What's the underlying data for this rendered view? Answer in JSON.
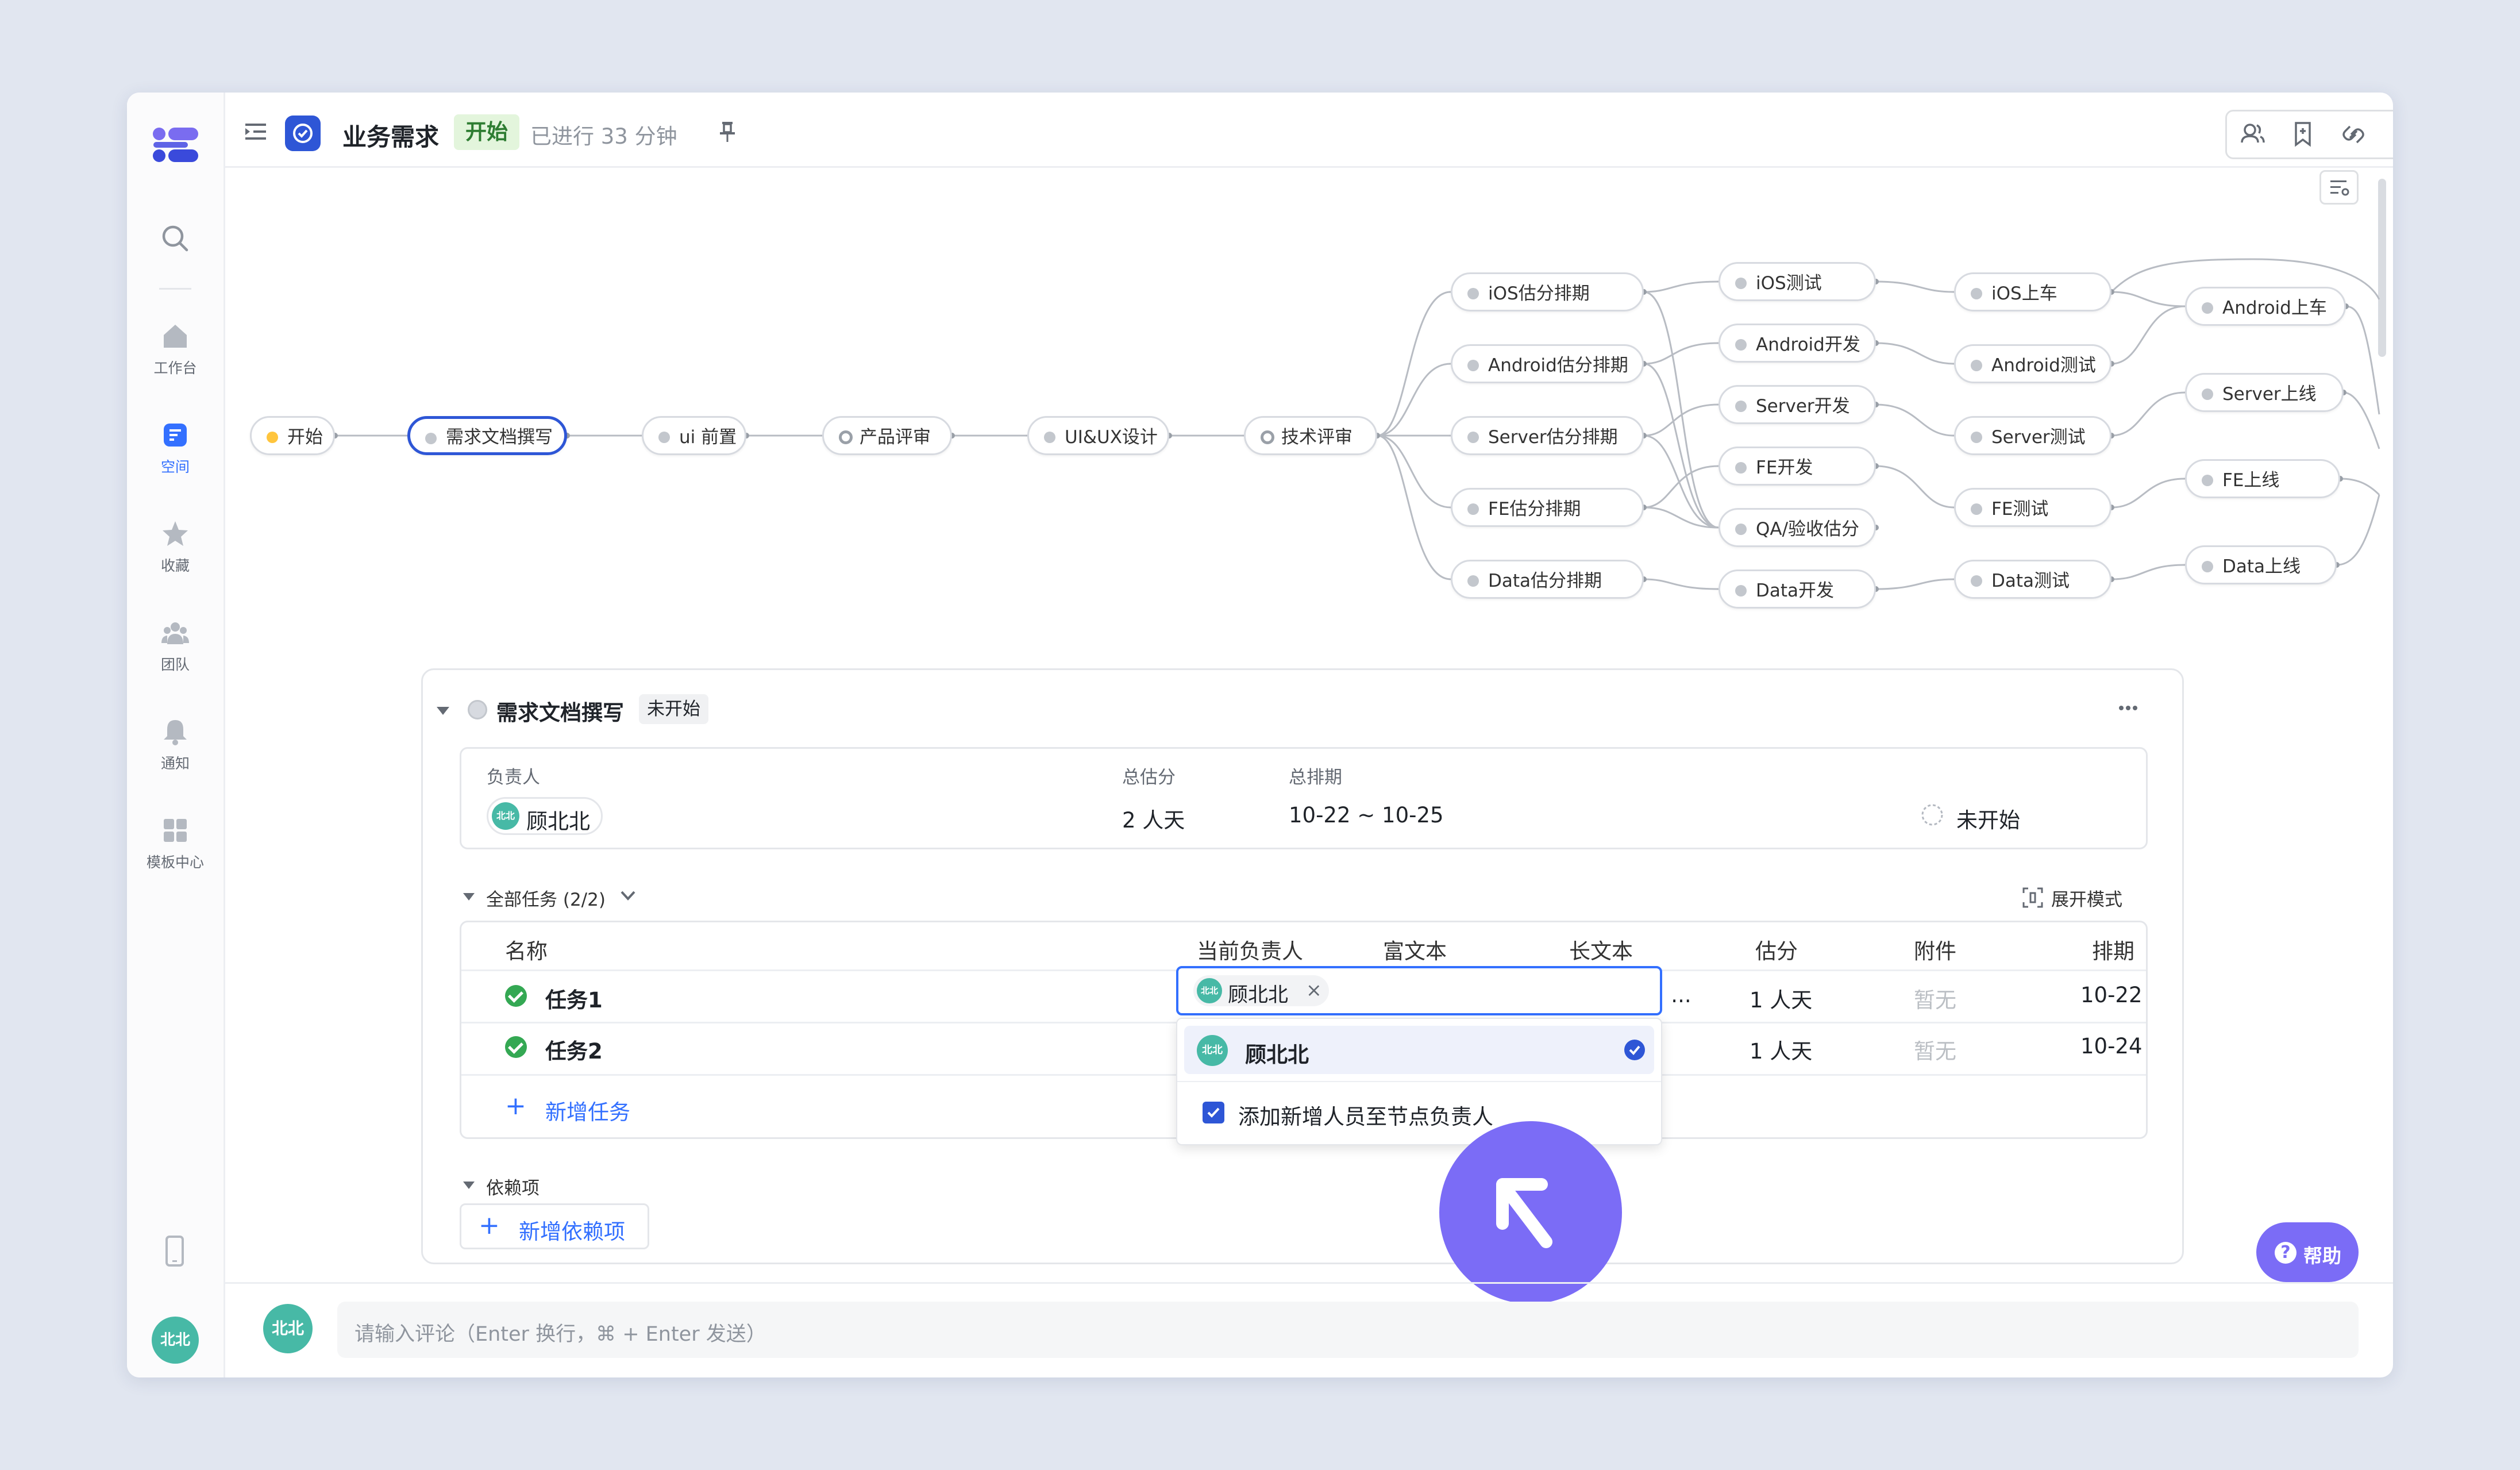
{
  "header": {
    "title": "业务需求",
    "status_badge": "开始",
    "elapsed": "已进行 33 分钟"
  },
  "sidebar": {
    "items": [
      {
        "label": "工作台",
        "icon": "home-icon"
      },
      {
        "label": "空间",
        "icon": "space-icon"
      },
      {
        "label": "收藏",
        "icon": "star-icon"
      },
      {
        "label": "团队",
        "icon": "team-icon"
      },
      {
        "label": "通知",
        "icon": "bell-icon"
      },
      {
        "label": "模板中心",
        "icon": "template-icon"
      }
    ],
    "user_avatar": "北北"
  },
  "flow": {
    "main": [
      "开始",
      "需求文档撰写",
      "ui 前置",
      "产品评审",
      "UI&UX设计",
      "技术评审"
    ],
    "estimate": [
      "iOS估分排期",
      "Android估分排期",
      "Server估分排期",
      "FE估分排期",
      "Data估分排期"
    ],
    "develop": [
      "iOS测试",
      "Android开发",
      "Server开发",
      "FE开发",
      "QA/验收估分",
      "Data开发"
    ],
    "test": [
      "iOS上车",
      "Android测试",
      "Server测试",
      "FE测试",
      "Data测试"
    ],
    "release": [
      "Android上车",
      "Server上线",
      "FE上线",
      "Data上线"
    ]
  },
  "panel": {
    "title": "需求文档撰写",
    "status": "未开始",
    "info": {
      "owner_label": "负责人",
      "owner": "顾北北",
      "owner_avatar": "北北",
      "estimate_label": "总估分",
      "estimate": "2 人天",
      "schedule_label": "总排期",
      "schedule": "10-22 ~ 10-25",
      "state": "未开始"
    },
    "tasks": {
      "section_label": "全部任务 (2/2)",
      "expand_mode": "展开模式",
      "columns": [
        "名称",
        "当前负责人",
        "富文本",
        "长文本",
        "估分",
        "附件",
        "排期"
      ],
      "rows": [
        {
          "name": "任务1",
          "longtext": "2 ...",
          "estimate": "1 人天",
          "attachment": "暂无",
          "schedule": "10-22"
        },
        {
          "name": "任务2",
          "estimate": "1 人天",
          "attachment": "暂无",
          "schedule": "10-24"
        }
      ],
      "add_task": "新增任务"
    },
    "dependencies": {
      "section_label": "依赖项",
      "add_dependency": "新增依赖项"
    }
  },
  "assignee_editor": {
    "chip": "顾北北",
    "chip_avatar": "北北",
    "option": "顾北北",
    "option_avatar": "北北",
    "checkbox_label": "添加新增人员至节点负责人"
  },
  "comment": {
    "placeholder": "请输入评论（Enter 换行，⌘ + Enter 发送）",
    "avatar": "北北"
  },
  "help_button": "帮助",
  "colors": {
    "accent": "#3370ff",
    "selected_border": "#2e56d6",
    "status_green_bg": "#e3f5dc",
    "check_green": "#34a853",
    "cursor_purple": "#7b6cf6",
    "avatar_teal": "#47b9a6"
  }
}
